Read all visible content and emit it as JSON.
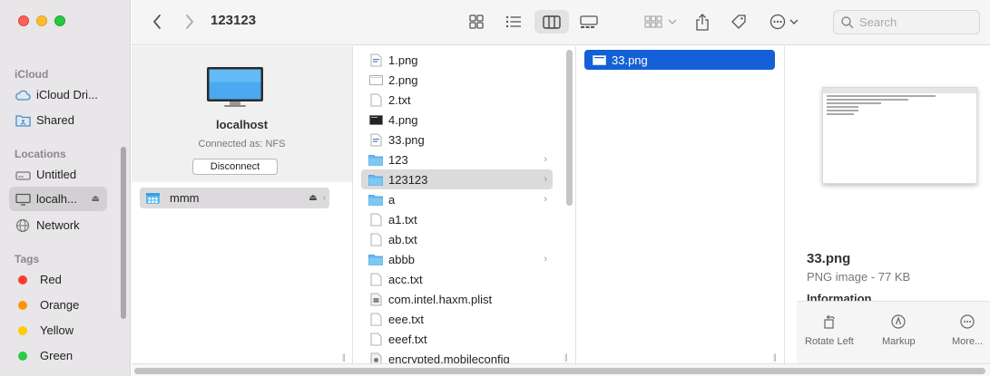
{
  "window": {
    "title": "123123"
  },
  "search": {
    "placeholder": "Search"
  },
  "sidebar": {
    "sections": {
      "icloud": "iCloud",
      "locations": "Locations",
      "tags": "Tags"
    },
    "icloud_items": [
      {
        "label": "iCloud Dri...",
        "icon": "cloud-icon"
      },
      {
        "label": "Shared",
        "icon": "shared-folder-icon"
      }
    ],
    "location_items": [
      {
        "label": "Untitled",
        "icon": "disk-icon"
      },
      {
        "label": "localh...",
        "icon": "display-icon"
      },
      {
        "label": "Network",
        "icon": "network-icon"
      }
    ],
    "tags": [
      {
        "label": "Red",
        "color": "#ff3b30"
      },
      {
        "label": "Orange",
        "color": "#ff9500"
      },
      {
        "label": "Yellow",
        "color": "#ffcc00"
      },
      {
        "label": "Green",
        "color": "#28cd41"
      }
    ]
  },
  "server": {
    "name": "localhost",
    "connected": "Connected as: NFS",
    "disconnect_label": "Disconnect",
    "share": "mmm"
  },
  "column2": {
    "items": [
      {
        "name": "1.png",
        "kind": "image"
      },
      {
        "name": "2.png",
        "kind": "image-light"
      },
      {
        "name": "2.txt",
        "kind": "text"
      },
      {
        "name": "4.png",
        "kind": "image-dark"
      },
      {
        "name": "33.png",
        "kind": "image"
      },
      {
        "name": "123",
        "kind": "folder"
      },
      {
        "name": "123123",
        "kind": "folder"
      },
      {
        "name": "a",
        "kind": "folder"
      },
      {
        "name": "a1.txt",
        "kind": "text"
      },
      {
        "name": "ab.txt",
        "kind": "text"
      },
      {
        "name": "abbb",
        "kind": "folder"
      },
      {
        "name": "acc.txt",
        "kind": "text"
      },
      {
        "name": "com.intel.haxm.plist",
        "kind": "plist"
      },
      {
        "name": "eee.txt",
        "kind": "text"
      },
      {
        "name": "eeef.txt",
        "kind": "text"
      },
      {
        "name": "encrypted.mobileconfig",
        "kind": "config"
      }
    ]
  },
  "column3": {
    "items": [
      {
        "name": "33.png"
      }
    ]
  },
  "preview": {
    "name": "33.png",
    "kind": "PNG image - 77 KB",
    "info_heading": "Information",
    "actions": [
      {
        "label": "Rotate Left",
        "icon": "rotate-left-icon"
      },
      {
        "label": "Markup",
        "icon": "markup-icon"
      },
      {
        "label": "More...",
        "icon": "more-icon"
      }
    ]
  }
}
